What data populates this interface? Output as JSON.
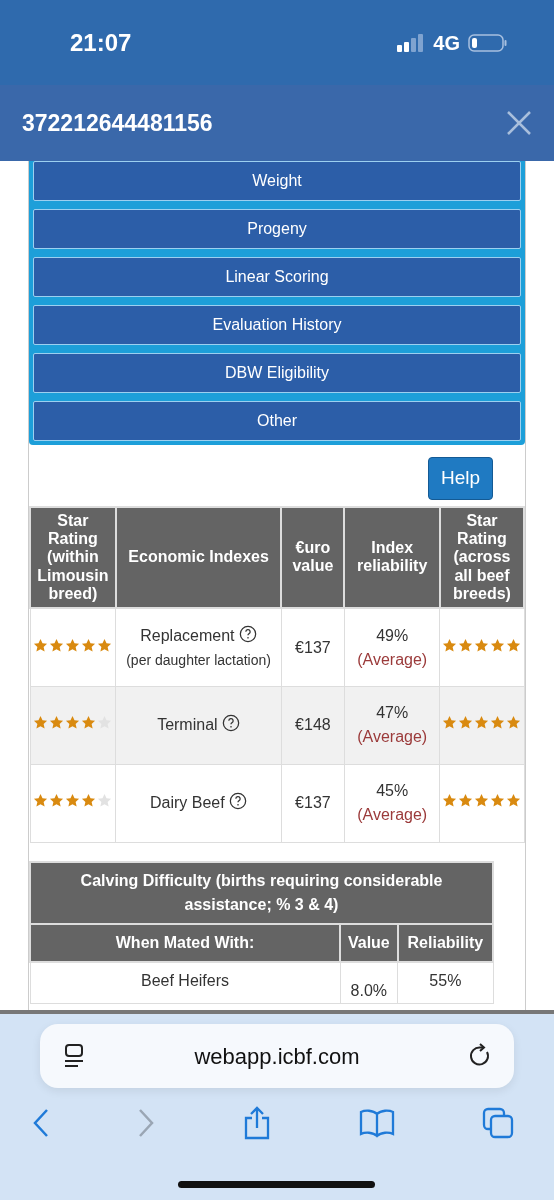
{
  "status_bar": {
    "time": "21:07",
    "network": "4G"
  },
  "header": {
    "title": "372212644481156"
  },
  "menu": {
    "items": [
      {
        "label": "Weight"
      },
      {
        "label": "Progeny"
      },
      {
        "label": "Linear Scoring"
      },
      {
        "label": "Evaluation History"
      },
      {
        "label": "DBW Eligibility"
      },
      {
        "label": "Other"
      }
    ]
  },
  "help_button": "Help",
  "index_table": {
    "columns": [
      "Star Rating (within Limousin breed)",
      "Economic Indexes",
      "€uro value",
      "Index reliability",
      "Star Rating (across all beef breeds)"
    ],
    "rows": [
      {
        "rating_within": {
          "stars": 5
        },
        "index": "Replacement",
        "note": "(per daughter lactation)",
        "value": "€137",
        "reliability": "49%",
        "reliability_label": "(Average)",
        "rating_across": {
          "stars": 5
        }
      },
      {
        "rating_within": {
          "stars": 4
        },
        "index": "Terminal",
        "value": "€148",
        "reliability": "47%",
        "reliability_label": "(Average)",
        "rating_across": {
          "stars": 5
        }
      },
      {
        "rating_within": {
          "stars": 4
        },
        "index": "Dairy Beef",
        "value": "€137",
        "reliability": "45%",
        "reliability_label": "(Average)",
        "rating_across": {
          "stars": 5
        }
      }
    ]
  },
  "calving_table": {
    "title": "Calving Difficulty (births requiring considerable assistance; % 3 & 4)",
    "columns": [
      "When Mated With:",
      "Value",
      "Reliability"
    ],
    "rows": [
      {
        "mated_with": "Beef Heifers",
        "value": "8.0%",
        "reliability": "55%"
      }
    ]
  },
  "browser": {
    "url": "webapp.icbf.com"
  }
}
